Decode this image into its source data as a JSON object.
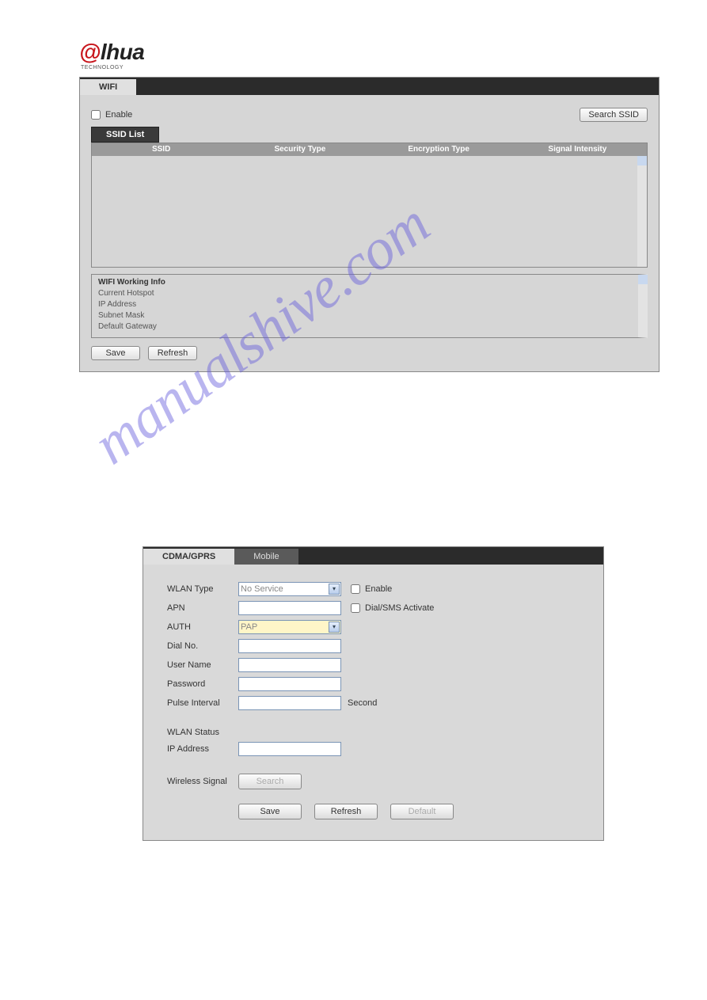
{
  "logo": {
    "part1": "@",
    "part2": "lhua",
    "sub": "TECHNOLOGY"
  },
  "watermark": "manualshive.com",
  "wifi_panel": {
    "tab": "WIFI",
    "enable_label": "Enable",
    "search_ssid_label": "Search SSID",
    "ssid_list_label": "SSID List",
    "columns": {
      "c1": "SSID",
      "c2": "Security Type",
      "c3": "Encryption Type",
      "c4": "Signal Intensity"
    },
    "working_info_title": "WIFI Working Info",
    "working_rows": {
      "r1": "Current Hotspot",
      "r2": "IP Address",
      "r3": "Subnet Mask",
      "r4": "Default Gateway"
    },
    "save_label": "Save",
    "refresh_label": "Refresh"
  },
  "cdma_panel": {
    "tab_active": "CDMA/GPRS",
    "tab_inactive": "Mobile",
    "fields": {
      "wlan_type": "WLAN Type",
      "wlan_type_value": "No Service",
      "apn": "APN",
      "auth": "AUTH",
      "auth_value": "PAP",
      "dial_no": "Dial No.",
      "user_name": "User Name",
      "password": "Password",
      "pulse_interval": "Pulse Interval",
      "pulse_unit": "Second",
      "wlan_status": "WLAN Status",
      "ip_address": "IP Address",
      "wireless_signal": "Wireless Signal"
    },
    "enable_label": "Enable",
    "dial_sms_label": "Dial/SMS Activate",
    "search_label": "Search",
    "save_label": "Save",
    "refresh_label": "Refresh",
    "default_label": "Default"
  }
}
